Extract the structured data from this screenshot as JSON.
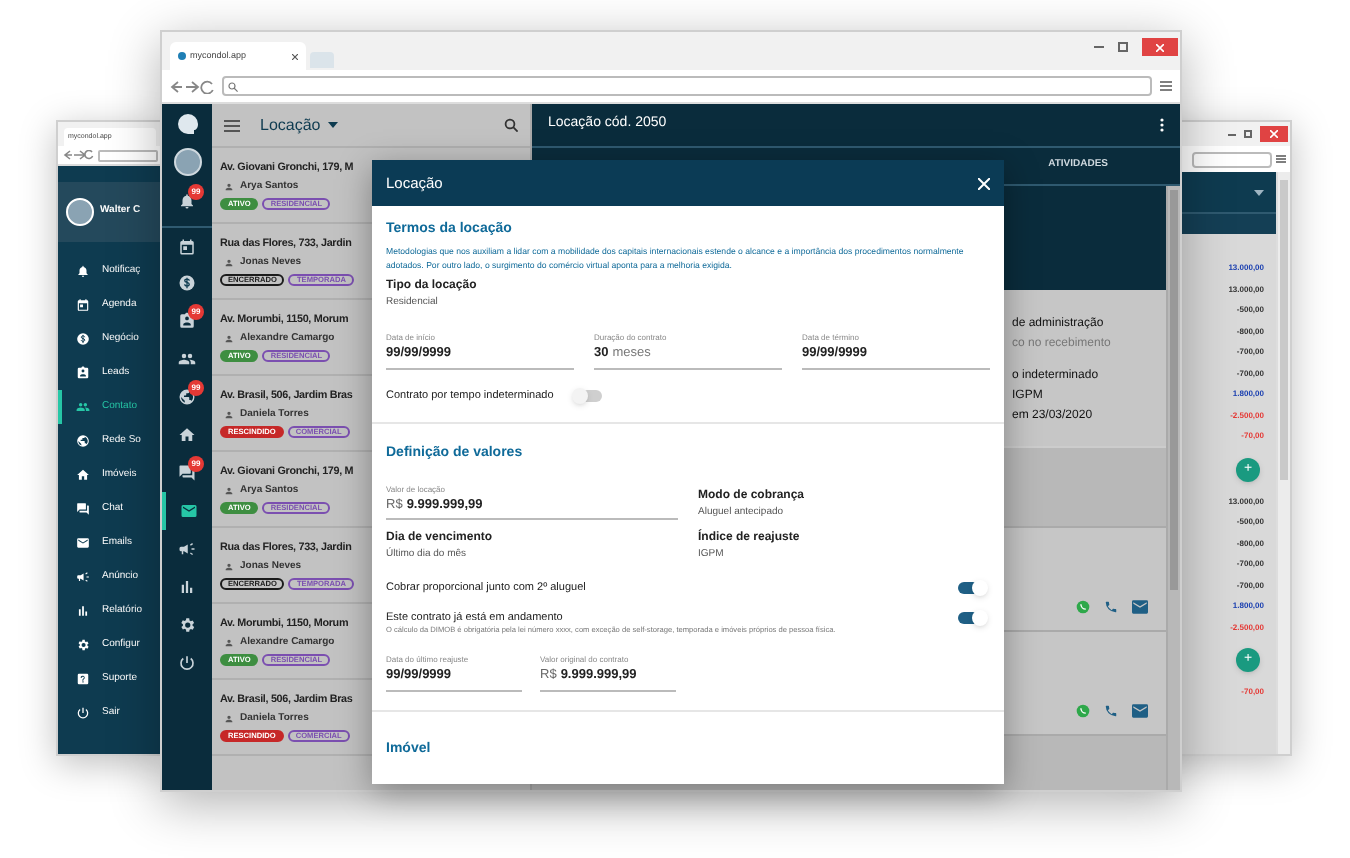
{
  "left_window": {
    "tab_title": "mycondol.app",
    "user_name": "Walter C",
    "menu": [
      {
        "label": "Notificaç",
        "selected": false
      },
      {
        "label": "Agenda",
        "selected": false
      },
      {
        "label": "Negócio",
        "selected": false
      },
      {
        "label": "Leads",
        "selected": false
      },
      {
        "label": "Contato",
        "selected": true
      },
      {
        "label": "Rede So",
        "selected": false
      },
      {
        "label": "Imóveis",
        "selected": false
      },
      {
        "label": "Chat",
        "selected": false
      },
      {
        "label": "Emails",
        "selected": false
      },
      {
        "label": "Anúncio",
        "selected": false
      },
      {
        "label": "Relatório",
        "selected": false
      },
      {
        "label": "Configur",
        "selected": false
      },
      {
        "label": "Suporte",
        "selected": false
      },
      {
        "label": "Sair",
        "selected": false
      }
    ]
  },
  "main_window": {
    "tab_title": "mycondol.app",
    "rail": [
      {
        "badge": "99",
        "selected": false
      },
      {
        "selected": false
      },
      {
        "selected": false
      },
      {
        "badge": "99",
        "selected": false
      },
      {
        "selected": false
      },
      {
        "badge": "99",
        "selected": false
      },
      {
        "selected": false
      },
      {
        "badge": "99",
        "selected": false
      },
      {
        "selected": true
      },
      {
        "selected": false
      },
      {
        "selected": false
      },
      {
        "selected": false
      },
      {
        "selected": false
      }
    ],
    "list": {
      "title": "Locação",
      "items": [
        {
          "address": "Av. Giovani Gronchi, 179, M",
          "person": "Arya Santos",
          "tags": [
            {
              "label": "ATIVO",
              "color": "#3e8e41",
              "kind": "solid"
            },
            {
              "label": "RESIDENCIAL",
              "color": "#7b4fb0",
              "kind": "outline"
            }
          ]
        },
        {
          "address": "Rua das Flores, 733, Jardin",
          "person": "Jonas Neves",
          "tags": [
            {
              "label": "ENCERRADO",
              "color": "#1c1c1c",
              "kind": "outline"
            },
            {
              "label": "TEMPORADA",
              "color": "#7b4fb0",
              "kind": "outline"
            }
          ]
        },
        {
          "address": "Av. Morumbi, 1150, Morum",
          "person": "Alexandre Camargo",
          "tags": [
            {
              "label": "ATIVO",
              "color": "#3e8e41",
              "kind": "solid"
            },
            {
              "label": "RESIDENCIAL",
              "color": "#7b4fb0",
              "kind": "outline"
            }
          ]
        },
        {
          "address": "Av. Brasil, 506, Jardim Bras",
          "person": "Daniela Torres",
          "tags": [
            {
              "label": "RESCINDIDO",
              "color": "#c62828",
              "kind": "solid"
            },
            {
              "label": "COMERCIAL",
              "color": "#7b4fb0",
              "kind": "outline"
            }
          ]
        },
        {
          "address": "Av. Giovani Gronchi, 179, M",
          "person": "Arya Santos",
          "tags": [
            {
              "label": "ATIVO",
              "color": "#3e8e41",
              "kind": "solid"
            },
            {
              "label": "RESIDENCIAL",
              "color": "#7b4fb0",
              "kind": "outline"
            }
          ]
        },
        {
          "address": "Rua das Flores, 733, Jardin",
          "person": "Jonas Neves",
          "tags": [
            {
              "label": "ENCERRADO",
              "color": "#1c1c1c",
              "kind": "outline"
            },
            {
              "label": "TEMPORADA",
              "color": "#7b4fb0",
              "kind": "outline"
            }
          ]
        },
        {
          "address": "Av. Morumbi, 1150, Morum",
          "person": "Alexandre Camargo",
          "tags": [
            {
              "label": "ATIVO",
              "color": "#3e8e41",
              "kind": "solid"
            },
            {
              "label": "RESIDENCIAL",
              "color": "#7b4fb0",
              "kind": "outline"
            }
          ]
        },
        {
          "address": "Av. Brasil, 506, Jardim Bras",
          "person": "Daniela Torres",
          "tags": [
            {
              "label": "RESCINDIDO",
              "color": "#c62828",
              "kind": "solid"
            },
            {
              "label": "COMERCIAL",
              "color": "#7b4fb0",
              "kind": "outline"
            }
          ]
        }
      ]
    },
    "detail": {
      "title": "Locação cód. 2050",
      "tab": "ATIVIDADES",
      "lines": [
        {
          "text": "de administração",
          "kind": "strong"
        },
        {
          "text": "co no recebimento",
          "kind": "muted"
        },
        {
          "text": "o indeterminado",
          "kind": "strong"
        },
        {
          "text": "IGPM",
          "kind": "strong"
        },
        {
          "text": "em 23/03/2020",
          "kind": "strong"
        }
      ]
    }
  },
  "modal": {
    "title": "Locação",
    "terms": {
      "heading": "Termos da locação",
      "description": "Metodologias que nos auxiliam a lidar com a mobilidade dos capitais internacionais estende o alcance e a importância dos procedimentos normalmente adotados. Por outro lado, o surgimento do comércio virtual aponta para a melhoria exigida.",
      "type_label": "Tipo da locação",
      "type_value": "Residencial",
      "fields": [
        {
          "label": "Data de início",
          "value": "99/99/9999"
        },
        {
          "label": "Duração do contrato",
          "value": "30",
          "suffix": "meses"
        },
        {
          "label": "Data de término",
          "value": "99/99/9999"
        }
      ],
      "toggle": {
        "label": "Contrato por tempo indeterminado",
        "on": false
      }
    },
    "values": {
      "heading": "Definição de valores",
      "rent": {
        "label": "Valor de locação",
        "prefix": "R$",
        "value": "9.999.999,99"
      },
      "billing": {
        "label": "Modo de cobrança",
        "value": "Aluguel antecipado"
      },
      "due_day": {
        "label": "Dia de vencimento",
        "value": "Último dia do mês"
      },
      "index": {
        "label": "Índice de reajuste",
        "value": "IGPM"
      },
      "toggles": [
        {
          "label": "Cobrar proporcional junto com 2º aluguel",
          "on": true
        },
        {
          "label": "Este contrato já está em andamento",
          "on": true,
          "note": "O cálculo da DIMOB é obrigatória pela lei número xxxx, com exceção de self-storage, temporada e imóveis próprios de pessoa física."
        }
      ],
      "fields": [
        {
          "label": "Data do último reajuste",
          "value": "99/99/9999"
        },
        {
          "label": "Valor original do contrato",
          "prefix": "R$",
          "value": "9.999.999,99"
        }
      ]
    },
    "next_heading": "Imóvel"
  },
  "right_window": {
    "rows": [
      {
        "kind": "amount",
        "text": "13.000,00",
        "color": "#1a3fb0"
      },
      {
        "kind": "amount",
        "text": "13.000,00",
        "color": "#333333"
      },
      {
        "kind": "amount",
        "text": "-500,00",
        "color": "#333333"
      },
      {
        "kind": "amount",
        "text": "-800,00",
        "color": "#333333"
      },
      {
        "kind": "amount",
        "text": "-700,00",
        "color": "#333333"
      },
      {
        "kind": "amount",
        "text": "-700,00",
        "color": "#333333"
      },
      {
        "kind": "amount",
        "text": "1.800,00",
        "color": "#1a3fb0"
      },
      {
        "kind": "amount",
        "text": "-2.500,00",
        "color": "#e53935"
      },
      {
        "kind": "amount",
        "text": "-70,00",
        "color": "#e53935"
      },
      {
        "kind": "add",
        "text": "+"
      },
      {
        "kind": "amount",
        "text": "13.000,00",
        "color": "#333333"
      },
      {
        "kind": "amount",
        "text": "-500,00",
        "color": "#333333"
      },
      {
        "kind": "amount",
        "text": "-800,00",
        "color": "#333333"
      },
      {
        "kind": "amount",
        "text": "-700,00",
        "color": "#333333"
      },
      {
        "kind": "amount",
        "text": "-700,00",
        "color": "#333333"
      },
      {
        "kind": "amount",
        "text": "1.800,00",
        "color": "#1a3fb0"
      },
      {
        "kind": "amount",
        "text": "-2.500,00",
        "color": "#e53935"
      },
      {
        "kind": "add",
        "text": "+"
      },
      {
        "kind": "amount",
        "text": "-70,00",
        "color": "#e53935"
      }
    ]
  }
}
